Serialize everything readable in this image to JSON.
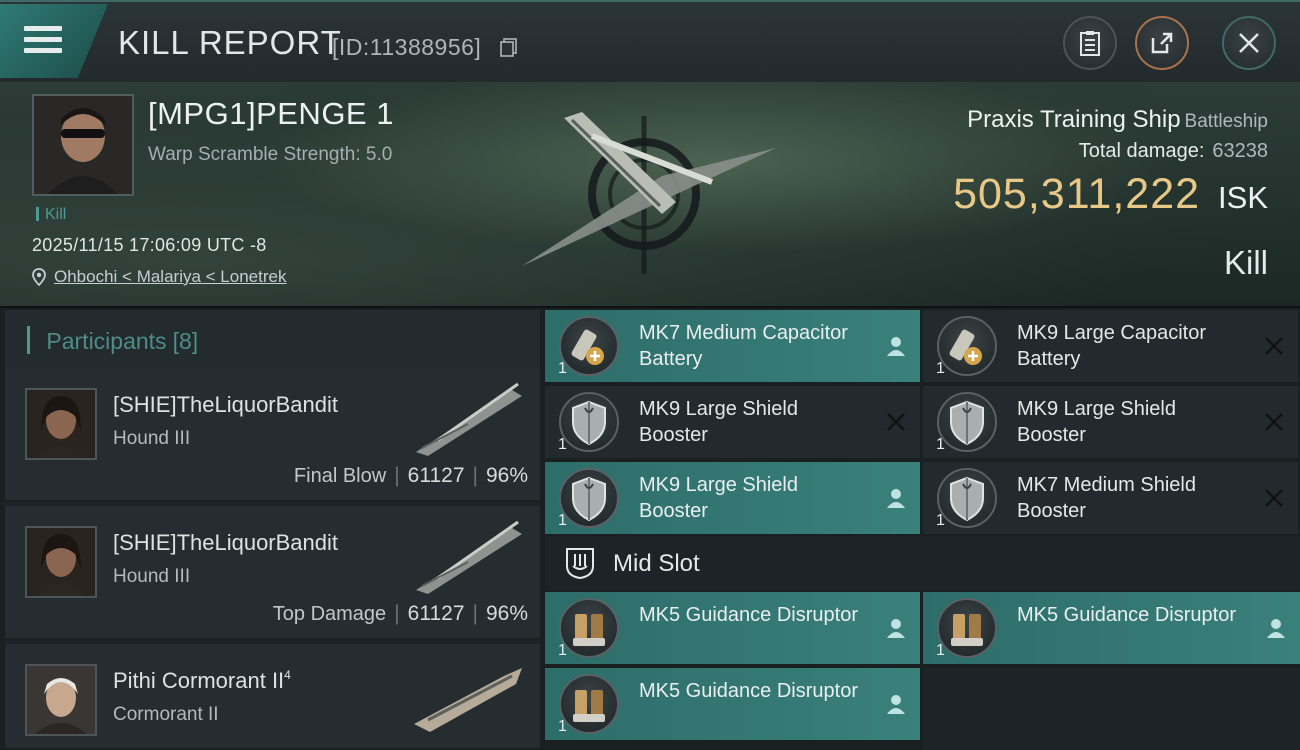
{
  "header": {
    "title": "KILL REPORT",
    "report_id": "[ID:11388956]",
    "icons": [
      "menu-icon",
      "copy-icon",
      "clipboard-icon",
      "share-icon",
      "close-icon"
    ]
  },
  "pilot": {
    "name": "[MPG1]PENGE 1",
    "scramble": "Warp Scramble Strength: 5.0",
    "kill_tag": "Kill",
    "datetime": "2025/11/15 17:06:09 UTC -8",
    "location": "Ohbochi < Malariya < Lonetrek"
  },
  "ship": {
    "name": "Praxis Training Ship",
    "class": "Battleship",
    "total_damage_label": "Total damage:",
    "total_damage": "63238",
    "isk_value": "505,311,222",
    "isk_unit": "ISK",
    "result": "Kill"
  },
  "participants": {
    "title": "Participants",
    "count": "[8]",
    "rows": [
      {
        "name": "[SHIE]TheLiquorBandit",
        "ship": "Hound III",
        "label": "Final Blow",
        "damage": "61127",
        "percent": "96%"
      },
      {
        "name": "[SHIE]TheLiquorBandit",
        "ship": "Hound III",
        "label": "Top Damage",
        "damage": "61127",
        "percent": "96%"
      },
      {
        "name": "Pithi Cormorant II",
        "sup": "4",
        "ship": "Cormorant II"
      }
    ]
  },
  "modules": {
    "low": [
      {
        "qty": "1",
        "name": "MK7 Medium Capacitor Battery",
        "state": "dropped",
        "icon": "capacitor-battery-icon"
      },
      {
        "qty": "1",
        "name": "MK9 Large Capacitor Battery",
        "state": "destroyed",
        "icon": "capacitor-battery-icon"
      },
      {
        "qty": "1",
        "name": "MK9 Large Shield Booster",
        "state": "destroyed",
        "icon": "shield-booster-icon"
      },
      {
        "qty": "1",
        "name": "MK9 Large Shield Booster",
        "state": "destroyed",
        "icon": "shield-booster-icon"
      },
      {
        "qty": "1",
        "name": "MK9 Large Shield Booster",
        "state": "dropped",
        "icon": "shield-booster-icon"
      },
      {
        "qty": "1",
        "name": "MK7 Medium Shield Booster",
        "state": "destroyed",
        "icon": "shield-booster-icon"
      }
    ],
    "mid_slot_label": "Mid Slot",
    "mid": [
      {
        "qty": "1",
        "name": "MK5 Guidance Disruptor",
        "state": "dropped",
        "icon": "guidance-disruptor-icon"
      },
      {
        "qty": "1",
        "name": "MK5 Guidance Disruptor",
        "state": "dropped",
        "icon": "guidance-disruptor-icon"
      },
      {
        "qty": "1",
        "name": "MK5 Guidance Disruptor",
        "state": "dropped",
        "icon": "guidance-disruptor-icon"
      }
    ]
  },
  "colors": {
    "accent": "#3a807b",
    "isk": "#e8c887",
    "background": "#1a1f22"
  }
}
